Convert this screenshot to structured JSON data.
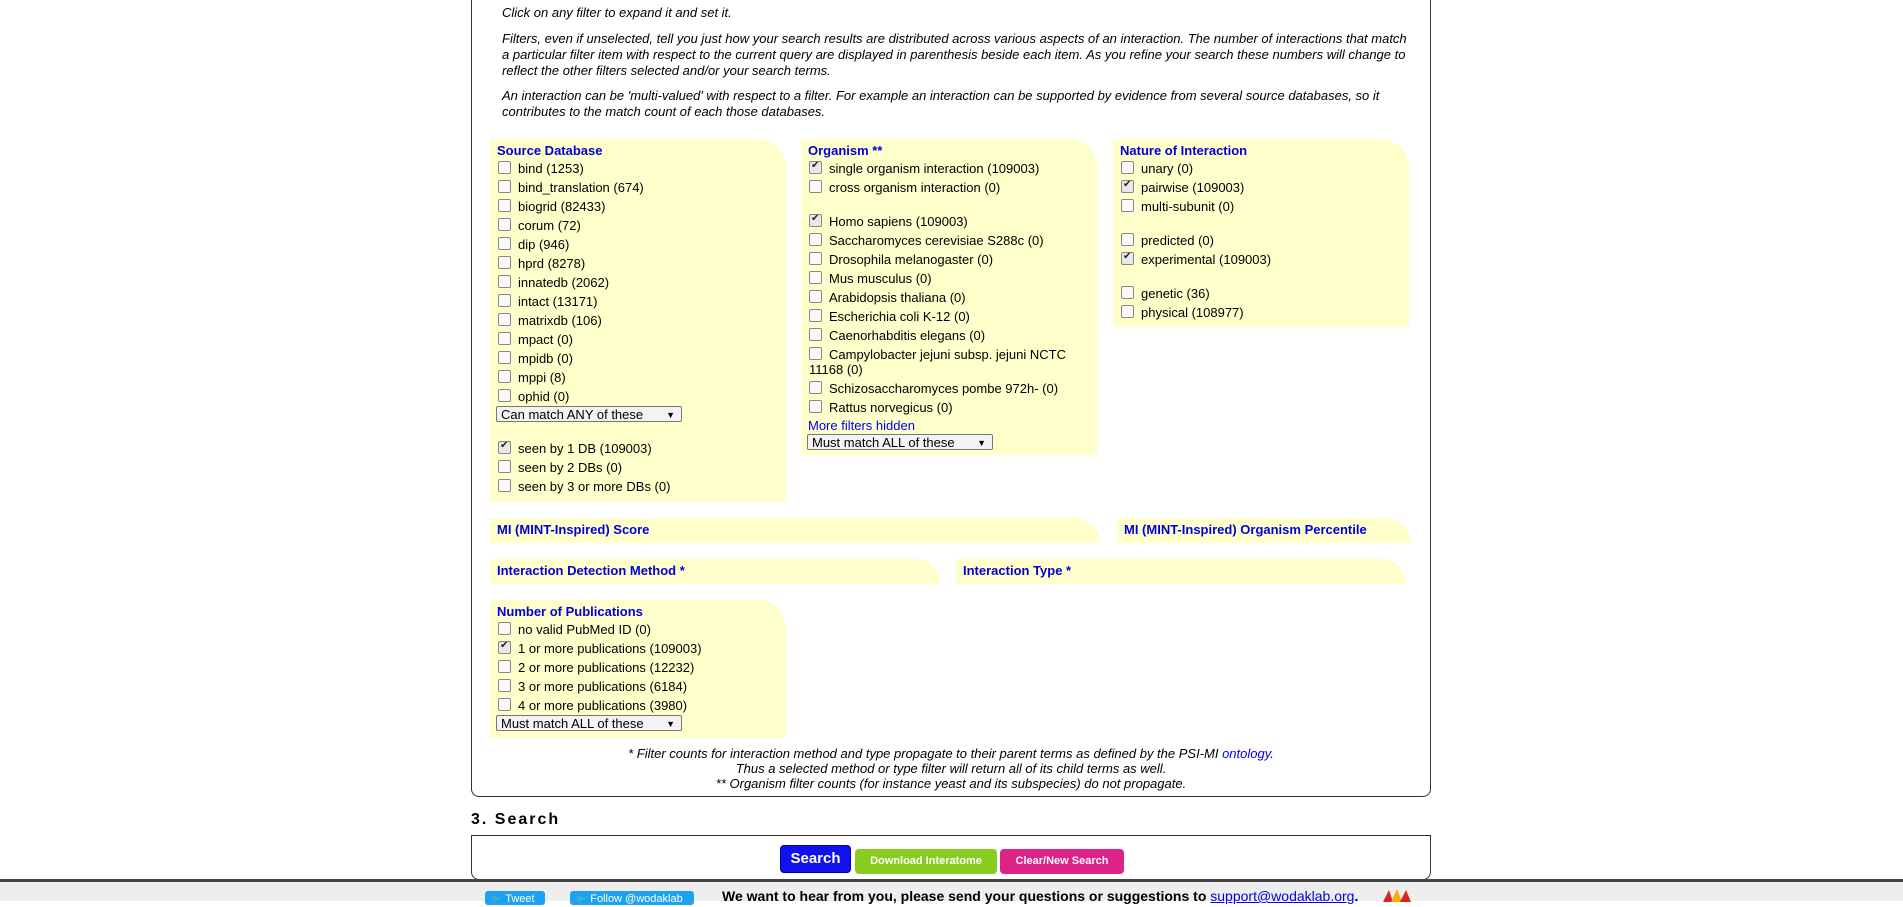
{
  "intro": {
    "line1": "Click on any filter to expand it and set it.",
    "para2": "Filters, even if unselected, tell you just how your search results are distributed across various aspects of an interaction. The number of interactions that match a particular filter item with respect to the current query are displayed in parenthesis beside each item. As you refine your search these numbers will change to reflect the other filters selected and/or your search terms.",
    "para3": "An interaction can be 'multi-valued' with respect to a filter. For example an interaction can be supported by evidence from several source databases, so it contributes to the match count of each those databases."
  },
  "source_db": {
    "title": "Source Database",
    "items": [
      {
        "label": "bind (1253)",
        "checked": false
      },
      {
        "label": "bind_translation (674)",
        "checked": false
      },
      {
        "label": "biogrid (82433)",
        "checked": false
      },
      {
        "label": "corum (72)",
        "checked": false
      },
      {
        "label": "dip (946)",
        "checked": false
      },
      {
        "label": "hprd (8278)",
        "checked": false
      },
      {
        "label": "innatedb (2062)",
        "checked": false
      },
      {
        "label": "intact (13171)",
        "checked": false
      },
      {
        "label": "matrixdb (106)",
        "checked": false
      },
      {
        "label": "mpact (0)",
        "checked": false
      },
      {
        "label": "mpidb (0)",
        "checked": false
      },
      {
        "label": "mppi (8)",
        "checked": false
      },
      {
        "label": "ophid (0)",
        "checked": false
      }
    ],
    "match_select": "Can match ANY of these",
    "seen": [
      {
        "label": "seen by 1 DB (109003)",
        "checked": true
      },
      {
        "label": "seen by 2 DBs (0)",
        "checked": false
      },
      {
        "label": "seen by 3 or more DBs (0)",
        "checked": false
      }
    ]
  },
  "organism": {
    "title": "Organism **",
    "scope": [
      {
        "label": "single organism interaction (109003)",
        "checked": true
      },
      {
        "label": "cross organism interaction (0)",
        "checked": false
      }
    ],
    "species": [
      {
        "label": "Homo sapiens (109003)",
        "checked": true
      },
      {
        "label": "Saccharomyces cerevisiae S288c (0)",
        "checked": false
      },
      {
        "label": "Drosophila melanogaster (0)",
        "checked": false
      },
      {
        "label": "Mus musculus (0)",
        "checked": false
      },
      {
        "label": "Arabidopsis thaliana (0)",
        "checked": false
      },
      {
        "label": "Escherichia coli K-12 (0)",
        "checked": false
      },
      {
        "label": "Caenorhabditis elegans (0)",
        "checked": false
      }
    ],
    "campylo_line1": "Campylobacter jejuni subsp. jejuni NCTC",
    "campylo_line2": "11168 (0)",
    "species2": [
      {
        "label": "Schizosaccharomyces pombe 972h- (0)",
        "checked": false
      },
      {
        "label": "Rattus norvegicus (0)",
        "checked": false
      }
    ],
    "more_link": "More filters hidden",
    "match_select": "Must match ALL of these"
  },
  "nature": {
    "title": "Nature of Interaction",
    "group1": [
      {
        "label": "unary (0)",
        "checked": false
      },
      {
        "label": "pairwise (109003)",
        "checked": true
      },
      {
        "label": "multi-subunit (0)",
        "checked": false
      }
    ],
    "group2": [
      {
        "label": "predicted (0)",
        "checked": false
      },
      {
        "label": "experimental (109003)",
        "checked": true
      }
    ],
    "group3": [
      {
        "label": "genetic (36)",
        "checked": false
      },
      {
        "label": "physical (108977)",
        "checked": false
      }
    ]
  },
  "mi_score": {
    "title": "MI (MINT-Inspired) Score"
  },
  "mi_percentile": {
    "title": "MI (MINT-Inspired) Organism Percentile"
  },
  "detection": {
    "title": "Interaction Detection Method *"
  },
  "itype": {
    "title": "Interaction Type *"
  },
  "publications": {
    "title": "Number of Publications",
    "items": [
      {
        "label": "no valid PubMed ID (0)",
        "checked": false
      },
      {
        "label": "1 or more publications (109003)",
        "checked": true
      },
      {
        "label": "2 or more publications (12232)",
        "checked": false
      },
      {
        "label": "3 or more publications (6184)",
        "checked": false
      },
      {
        "label": "4 or more publications (3980)",
        "checked": false
      }
    ],
    "match_select": "Must match ALL of these"
  },
  "notes": {
    "line1_pre": "* Filter counts for interaction method and type propagate to their parent terms as defined by the PSI-MI ",
    "line1_link": "ontology",
    "line1_post": ".",
    "line2": "Thus a selected method or type filter will return all of its child terms as well.",
    "line3": "** Organism filter counts (for instance yeast and its subspecies) do not propagate."
  },
  "search": {
    "heading": "3. Search",
    "search_label": "Search",
    "download_label": "Download Interatome",
    "clear_label": "Clear/New Search"
  },
  "footer": {
    "tweet": "Tweet",
    "follow": "Follow @wodaklab",
    "message": "We want to hear from you, please send your questions or suggestions to ",
    "email": "support@wodaklab.org",
    "message_end": "."
  },
  "colors": {
    "panel_bg": "#ffffcc",
    "title_blue": "#0000dd",
    "search_btn": "#1111ee",
    "download_btn": "#88cc22",
    "clear_btn": "#dd2288"
  }
}
